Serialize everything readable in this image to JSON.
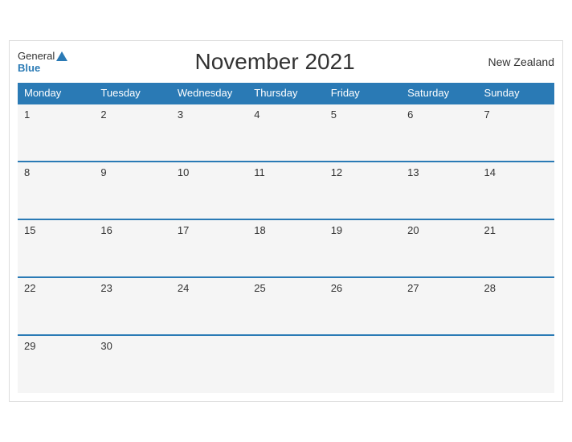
{
  "header": {
    "logo_general": "General",
    "logo_blue": "Blue",
    "title": "November 2021",
    "country": "New Zealand"
  },
  "days": [
    "Monday",
    "Tuesday",
    "Wednesday",
    "Thursday",
    "Friday",
    "Saturday",
    "Sunday"
  ],
  "weeks": [
    [
      {
        "date": "1",
        "empty": false
      },
      {
        "date": "2",
        "empty": false
      },
      {
        "date": "3",
        "empty": false
      },
      {
        "date": "4",
        "empty": false
      },
      {
        "date": "5",
        "empty": false
      },
      {
        "date": "6",
        "empty": false
      },
      {
        "date": "7",
        "empty": false
      }
    ],
    [
      {
        "date": "8",
        "empty": false
      },
      {
        "date": "9",
        "empty": false
      },
      {
        "date": "10",
        "empty": false
      },
      {
        "date": "11",
        "empty": false
      },
      {
        "date": "12",
        "empty": false
      },
      {
        "date": "13",
        "empty": false
      },
      {
        "date": "14",
        "empty": false
      }
    ],
    [
      {
        "date": "15",
        "empty": false
      },
      {
        "date": "16",
        "empty": false
      },
      {
        "date": "17",
        "empty": false
      },
      {
        "date": "18",
        "empty": false
      },
      {
        "date": "19",
        "empty": false
      },
      {
        "date": "20",
        "empty": false
      },
      {
        "date": "21",
        "empty": false
      }
    ],
    [
      {
        "date": "22",
        "empty": false
      },
      {
        "date": "23",
        "empty": false
      },
      {
        "date": "24",
        "empty": false
      },
      {
        "date": "25",
        "empty": false
      },
      {
        "date": "26",
        "empty": false
      },
      {
        "date": "27",
        "empty": false
      },
      {
        "date": "28",
        "empty": false
      }
    ],
    [
      {
        "date": "29",
        "empty": false
      },
      {
        "date": "30",
        "empty": false
      },
      {
        "date": "",
        "empty": true
      },
      {
        "date": "",
        "empty": true
      },
      {
        "date": "",
        "empty": true
      },
      {
        "date": "",
        "empty": true
      },
      {
        "date": "",
        "empty": true
      }
    ]
  ]
}
